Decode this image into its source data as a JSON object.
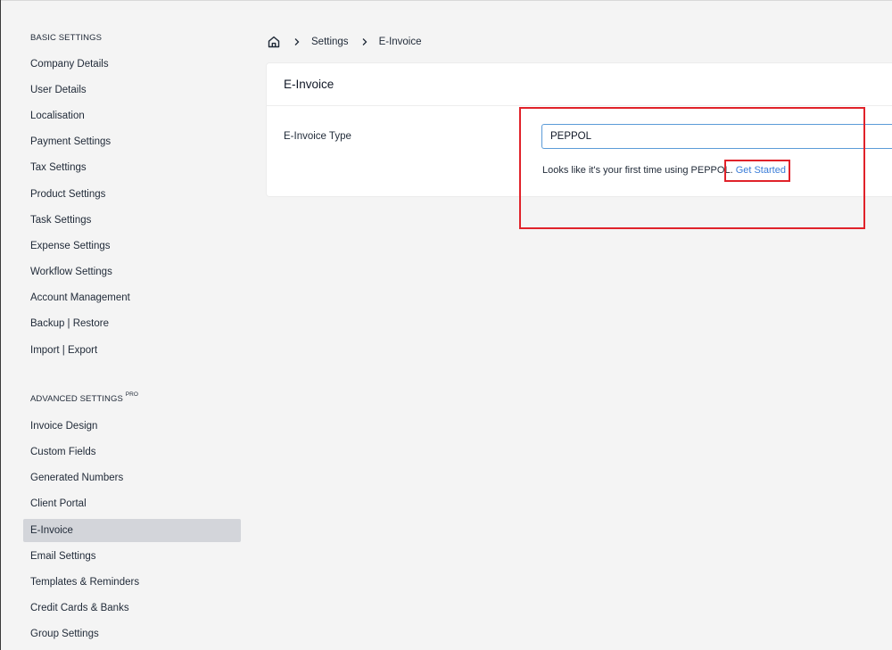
{
  "sidebar": {
    "basic_title": "BASIC SETTINGS",
    "basic_items": [
      "Company Details",
      "User Details",
      "Localisation",
      "Payment Settings",
      "Tax Settings",
      "Product Settings",
      "Task Settings",
      "Expense Settings",
      "Workflow Settings",
      "Account Management",
      "Backup | Restore",
      "Import | Export"
    ],
    "advanced_title": "ADVANCED SETTINGS",
    "advanced_badge": "PRO",
    "advanced_items": [
      "Invoice Design",
      "Custom Fields",
      "Generated Numbers",
      "Client Portal",
      "E-Invoice",
      "Email Settings",
      "Templates & Reminders",
      "Credit Cards & Banks",
      "Group Settings"
    ],
    "active_item": "E-Invoice"
  },
  "breadcrumb": {
    "home_icon": "home-icon",
    "items": [
      "Settings",
      "E-Invoice"
    ]
  },
  "card": {
    "title": "E-Invoice",
    "field_label": "E-Invoice Type",
    "field_value": "PEPPOL",
    "helper_text": "Looks like it's your first time using PEPPOL.",
    "helper_link": "Get Started"
  },
  "colors": {
    "background": "#f4f4f4",
    "active_item_bg": "#d3d5da",
    "link": "#3b7dd8",
    "input_border": "#5b9bd8",
    "annotation": "#e0222a"
  }
}
